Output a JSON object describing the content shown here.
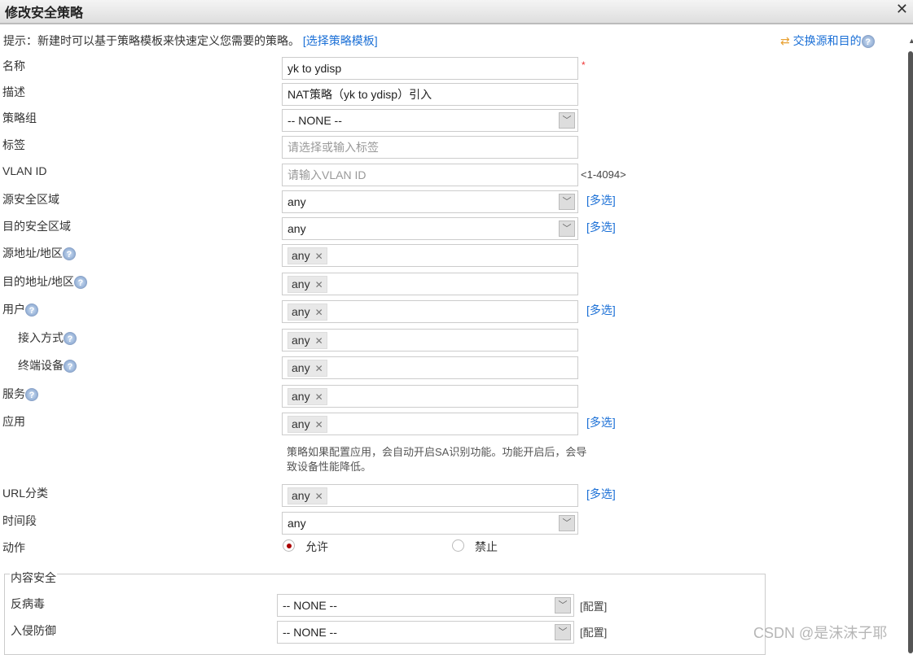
{
  "dialog": {
    "title": "修改安全策略",
    "close": "✕"
  },
  "tip": {
    "text": "提示：新建时可以基于策略模板来快速定义您需要的策略。",
    "link": "[选择策略模板]"
  },
  "swap": {
    "icon": "swap-arrows-icon",
    "label": "交换源和目的",
    "help": "?"
  },
  "rows": [
    {
      "key": "name",
      "label": "名称",
      "type": "input",
      "value": "yk to ydisp",
      "required": "*"
    },
    {
      "key": "desc",
      "label": "描述",
      "type": "input",
      "value": "NAT策略（yk to ydisp）引入"
    },
    {
      "key": "group",
      "label": "策略组",
      "type": "select",
      "value": "-- NONE --"
    },
    {
      "key": "tag",
      "label": "标签",
      "type": "input",
      "placeholder": "请选择或输入标签"
    },
    {
      "key": "vlan",
      "label": "VLAN ID",
      "type": "input",
      "placeholder": "请输入VLAN ID",
      "hint": "<1-4094>"
    },
    {
      "key": "src-zone",
      "label": "源安全区域",
      "type": "select",
      "value": "any",
      "extra": "[多选]"
    },
    {
      "key": "dst-zone",
      "label": "目的安全区域",
      "type": "select",
      "value": "any",
      "extra": "[多选]"
    },
    {
      "key": "src-addr",
      "label": "源地址/地区",
      "help": "?",
      "type": "tags",
      "value": "any"
    },
    {
      "key": "dst-addr",
      "label": "目的地址/地区",
      "help": "?",
      "type": "tags",
      "value": "any"
    },
    {
      "key": "user",
      "label": "用户",
      "help": "?",
      "type": "tags",
      "value": "any",
      "extra": "[多选]"
    },
    {
      "key": "access",
      "label": "接入方式",
      "help": "?",
      "type": "tags",
      "value": "any",
      "indent": true
    },
    {
      "key": "terminal",
      "label": "终端设备",
      "help": "?",
      "type": "tags",
      "value": "any",
      "indent": true
    },
    {
      "key": "service",
      "label": "服务",
      "help": "?",
      "type": "tags",
      "value": "any"
    },
    {
      "key": "app",
      "label": "应用",
      "type": "tags",
      "value": "any",
      "extra": "[多选]"
    },
    {
      "key": "url",
      "label": "URL分类",
      "type": "tags",
      "value": "any",
      "extra": "[多选]"
    },
    {
      "key": "schedule",
      "label": "时间段",
      "type": "select",
      "value": "any"
    }
  ],
  "app_note": "策略如果配置应用，会自动开启SA识别功能。功能开启后，会导致设备性能降低。",
  "action": {
    "label": "动作",
    "options": [
      {
        "label": "允许",
        "selected": true
      },
      {
        "label": "禁止",
        "selected": false
      }
    ]
  },
  "content_security": {
    "legend": "内容安全",
    "rows": [
      {
        "label": "反病毒",
        "value": "-- NONE --",
        "extra": "[配置]"
      },
      {
        "label": "入侵防御",
        "value": "-- NONE --",
        "extra": "[配置]"
      }
    ]
  },
  "watermark": "CSDN @是沫沫子耶"
}
